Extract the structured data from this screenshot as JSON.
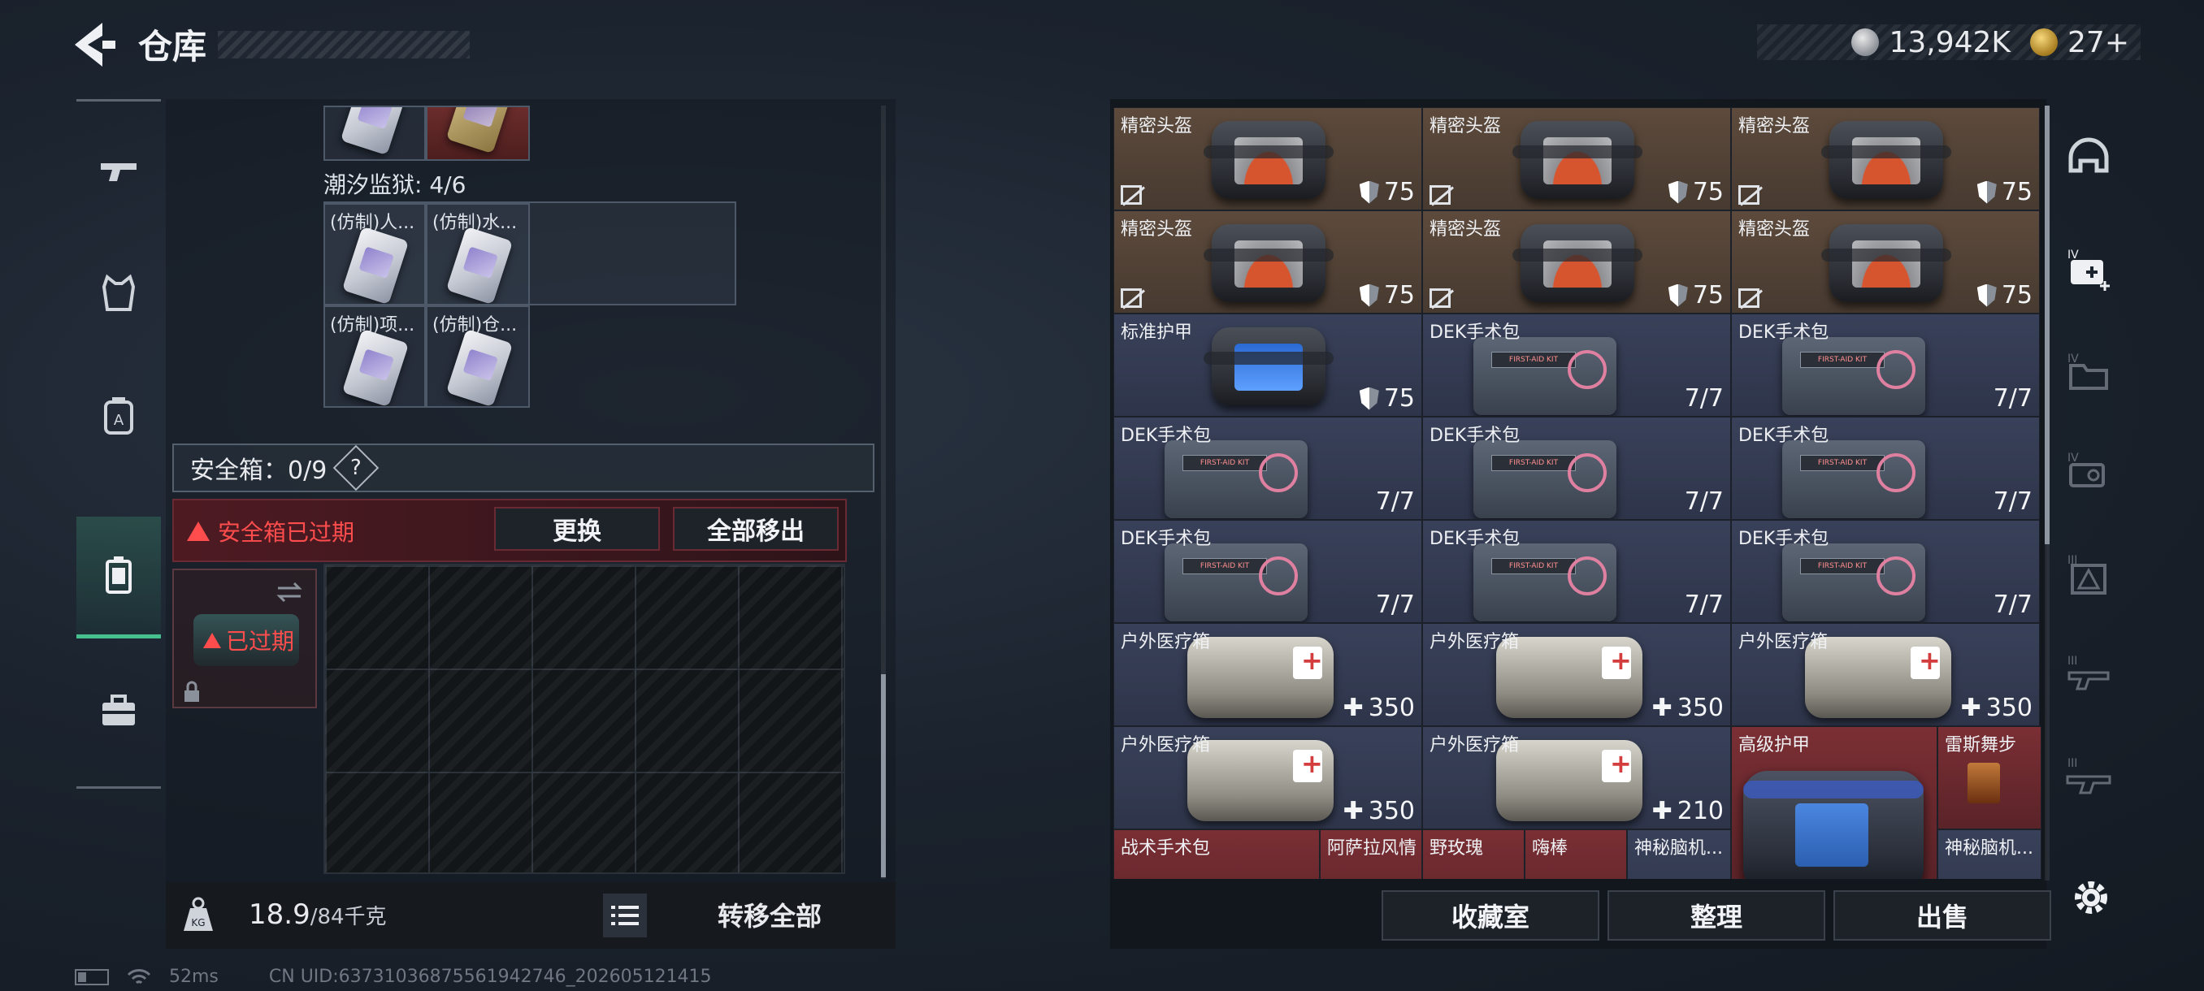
{
  "header": {
    "title": "仓库",
    "currency_1": "13,942K",
    "currency_2": "27+"
  },
  "left_nav": {
    "items": [
      "firearm-icon",
      "armor-vest-icon",
      "backpack-icon",
      "safe-box-icon",
      "toolbox-icon"
    ],
    "active_index": 3
  },
  "container": {
    "section_title": "潮汐监狱: 4/6",
    "slots": [
      "(仿制)人...",
      "(仿制)水...",
      "(仿制)项...",
      "(仿制)仓..."
    ]
  },
  "safe_box": {
    "label": "安全箱：0/9",
    "help": "?",
    "expired_text": "安全箱已过期",
    "replace_button": "更换",
    "remove_all_button": "全部移出",
    "box_status": "已过期"
  },
  "weight": {
    "current": "18.9",
    "max": "/84千克",
    "transfer_all_button": "转移全部"
  },
  "inventory": {
    "rows": [
      [
        {
          "label": "精密头盔",
          "value": "75",
          "type": "helmet",
          "color": "brown",
          "flag": true
        },
        {
          "label": "精密头盔",
          "value": "75",
          "type": "helmet",
          "color": "brown",
          "flag": true
        },
        {
          "label": "精密头盔",
          "value": "75",
          "type": "helmet",
          "color": "brown",
          "flag": true
        }
      ],
      [
        {
          "label": "精密头盔",
          "value": "75",
          "type": "helmet",
          "color": "brown",
          "flag": true
        },
        {
          "label": "精密头盔",
          "value": "75",
          "type": "helmet",
          "color": "brown",
          "flag": true
        },
        {
          "label": "精密头盔",
          "value": "75",
          "type": "helmet",
          "color": "brown",
          "flag": true
        }
      ],
      [
        {
          "label": "标准护甲",
          "value": "75",
          "type": "armor",
          "color": "slate",
          "flag": false
        },
        {
          "label": "DEK手术包",
          "value": "7/7",
          "type": "kit",
          "color": "slate",
          "flag": false
        },
        {
          "label": "DEK手术包",
          "value": "7/7",
          "type": "kit",
          "color": "slate",
          "flag": false
        }
      ],
      [
        {
          "label": "DEK手术包",
          "value": "7/7",
          "type": "kit",
          "color": "slate",
          "flag": false
        },
        {
          "label": "DEK手术包",
          "value": "7/7",
          "type": "kit",
          "color": "slate",
          "flag": false
        },
        {
          "label": "DEK手术包",
          "value": "7/7",
          "type": "kit",
          "color": "slate",
          "flag": false
        }
      ],
      [
        {
          "label": "DEK手术包",
          "value": "7/7",
          "type": "kit",
          "color": "slate",
          "flag": false
        },
        {
          "label": "DEK手术包",
          "value": "7/7",
          "type": "kit",
          "color": "slate",
          "flag": false
        },
        {
          "label": "DEK手术包",
          "value": "7/7",
          "type": "kit",
          "color": "slate",
          "flag": false
        }
      ],
      [
        {
          "label": "户外医疗箱",
          "value": "350",
          "type": "medbox",
          "color": "slate",
          "flag": false
        },
        {
          "label": "户外医疗箱",
          "value": "350",
          "type": "medbox",
          "color": "slate",
          "flag": false
        },
        {
          "label": "户外医疗箱",
          "value": "350",
          "type": "medbox",
          "color": "slate",
          "flag": false
        }
      ]
    ],
    "row7": {
      "cell1": {
        "label": "户外医疗箱",
        "value": "350"
      },
      "cell2": {
        "label": "户外医疗箱",
        "value": "210"
      },
      "big_armor": {
        "label": "高级护甲"
      },
      "drink": {
        "label": "雷斯舞步"
      }
    },
    "row8": [
      "战术手术包",
      "阿萨拉风情",
      "野玫瑰",
      "嗨棒",
      "神秘脑机...",
      "神秘脑机..."
    ]
  },
  "right_tabs": [
    "helmet-tab-icon",
    "medkit-tab-icon",
    "folder-tab-icon",
    "key-tab-icon",
    "warning-tab-icon",
    "weapon-tab-icon",
    "rifle-tab-icon"
  ],
  "actions": {
    "collection_button": "收藏室",
    "sort_button": "整理",
    "sell_button": "出售"
  },
  "status": {
    "ping": "52ms",
    "uid": "CN UID:6373103687556194274​6_202605121415"
  }
}
